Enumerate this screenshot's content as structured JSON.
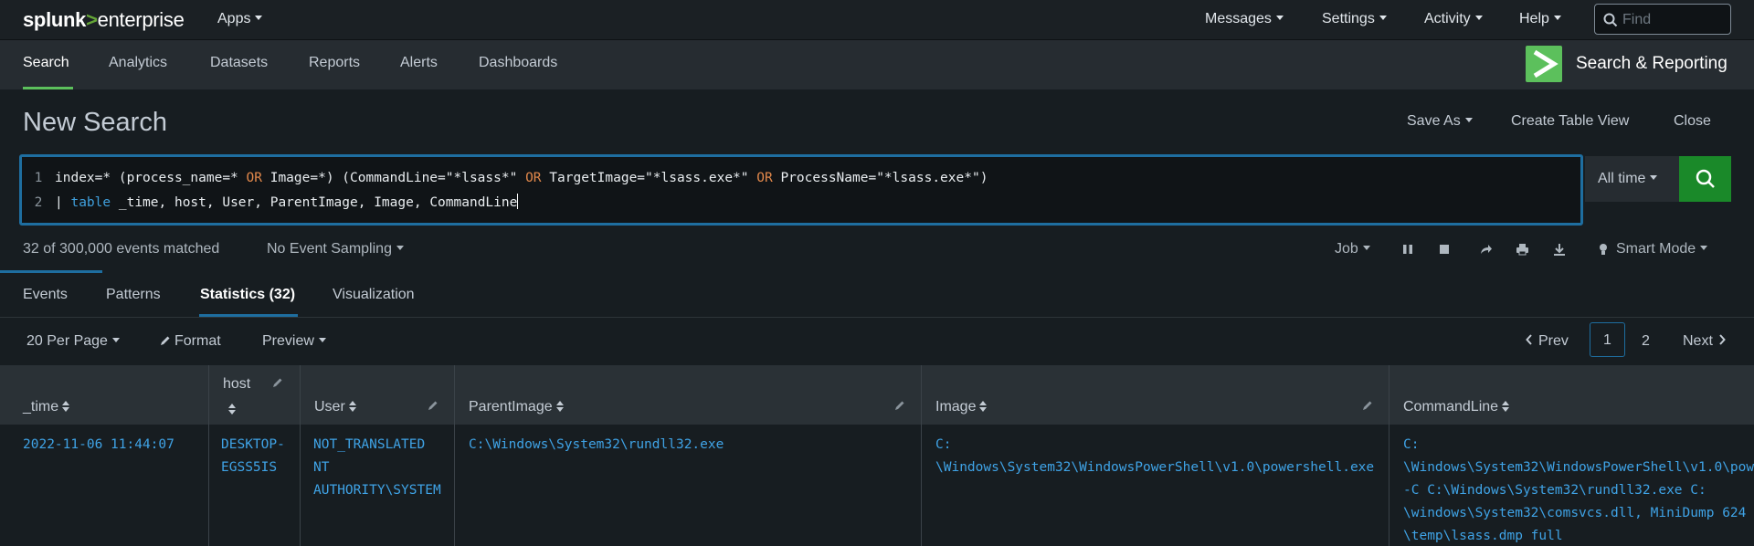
{
  "topbar": {
    "logo_splunk": "splunk",
    "logo_gt": ">",
    "logo_product": "enterprise",
    "menus": [
      "Apps",
      "Messages",
      "Settings",
      "Activity",
      "Help"
    ],
    "find_placeholder": "Find"
  },
  "appbar": {
    "tabs": [
      "Search",
      "Analytics",
      "Datasets",
      "Reports",
      "Alerts",
      "Dashboards"
    ],
    "active_tab": "Search",
    "app_name": "Search & Reporting"
  },
  "search": {
    "title": "New Search",
    "actions": {
      "save_as": "Save As",
      "create_table_view": "Create Table View",
      "close": "Close"
    },
    "line1": {
      "num": "1",
      "p1": "index=* (process_name=* ",
      "k1": "OR",
      "p2": " Image=*) (CommandLine=\"*lsass*\" ",
      "k2": "OR",
      "p3": " TargetImage=\"*lsass.exe*\" ",
      "k3": "OR",
      "p4": " ProcessName=\"*lsass.exe*\")"
    },
    "line2": {
      "num": "2",
      "pipe": "| ",
      "cmd": "table",
      "rest": " _time, host, User, ParentImage, Image, CommandLine"
    },
    "time_range": "All time"
  },
  "status": {
    "events_matched": "32 of 300,000 events matched",
    "sampling": "No Event Sampling",
    "job": "Job",
    "mode": "Smart Mode"
  },
  "result_tabs": {
    "events": "Events",
    "patterns": "Patterns",
    "statistics": "Statistics (32)",
    "visualization": "Visualization"
  },
  "table_controls": {
    "per_page": "20 Per Page",
    "format": "Format",
    "preview": "Preview",
    "prev": "Prev",
    "pages": [
      "1",
      "2"
    ],
    "current_page": "1",
    "next": "Next"
  },
  "table": {
    "columns": [
      "_time",
      "host",
      "User",
      "ParentImage",
      "Image",
      "CommandLine"
    ],
    "rows": [
      {
        "_time": "2022-11-06 11:44:07",
        "host": "DESKTOP-\nEGSS5IS",
        "User": "NOT_TRANSLATED\nNT\nAUTHORITY\\SYSTEM",
        "ParentImage": "C:\\Windows\\System32\\rundll32.exe",
        "Image": "C:\n\\Windows\\System32\\WindowsPowerShell\\v1.0\\powershell.exe",
        "CommandLine": "C:\n\\Windows\\System32\\WindowsPowerShell\\v1.0\\pow\n-C C:\\Windows\\System32\\rundll32.exe C:\n\\windows\\System32\\comsvcs.dll, MiniDump 624\n\\temp\\lsass.dmp full"
      }
    ]
  },
  "colors": {
    "accent_green": "#5cc05c",
    "search_button": "#1a8929",
    "accent_blue": "#1e6ea0",
    "link_blue": "#3fa3e6",
    "keyword_orange": "#e2884b"
  }
}
